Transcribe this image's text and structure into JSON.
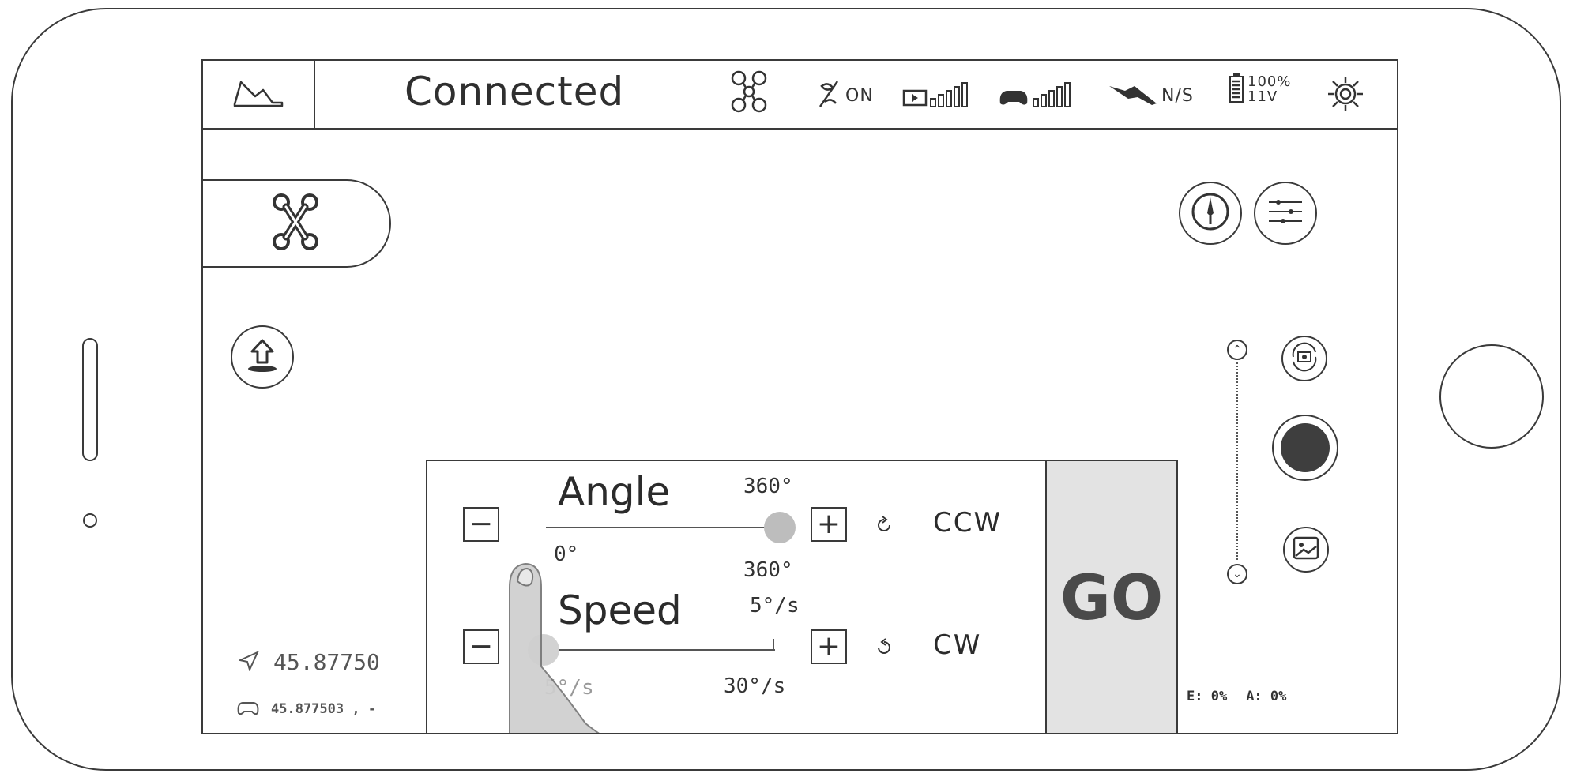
{
  "topbar": {
    "status": "Connected",
    "gps_status": "ON",
    "satellite_status": "N/S",
    "battery_percent": "100%",
    "battery_voltage": "11V"
  },
  "rotation_panel": {
    "angle": {
      "label": "Angle",
      "max_top": "360°",
      "min": "0°",
      "max_bottom": "360°",
      "direction": "CCW",
      "level": 1.0
    },
    "speed": {
      "label": "Speed",
      "min_top": "5°/s",
      "min": "5°/s",
      "max": "30°/s",
      "direction": "CW",
      "level": 0.0
    },
    "minus_label": "−",
    "plus_label": "+",
    "go_label": "GO"
  },
  "coords": {
    "aircraft": "45.87750",
    "controller": "45.877503 , -"
  },
  "stats": {
    "e": "E: 0%",
    "a": "A: 0%"
  },
  "icons": [
    "map-icon",
    "drone-status-icon",
    "gps-icon",
    "video-signal-icon",
    "controller-signal-icon",
    "satellite-icon",
    "battery-icon",
    "settings-icon",
    "drone-mode-icon",
    "compass-icon",
    "camera-settings-icon",
    "takeoff-icon",
    "camera-switch-icon",
    "shutter-icon",
    "gallery-icon",
    "zoom-up-icon",
    "zoom-down-icon",
    "aircraft-location-icon",
    "controller-location-icon",
    "rotate-ccw-icon",
    "rotate-cw-icon"
  ]
}
